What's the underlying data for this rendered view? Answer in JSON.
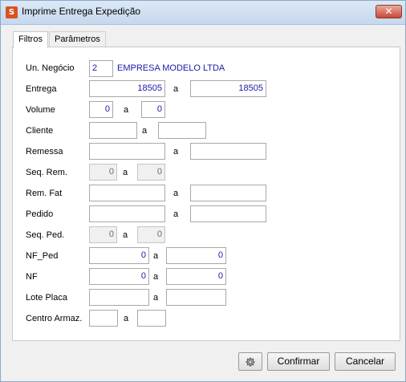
{
  "window": {
    "title": "Imprime Entrega Expedição",
    "close_glyph": "✕",
    "app_icon": "app-icon",
    "app_icon_glyph": "S"
  },
  "tabs": [
    {
      "label": "Filtros",
      "active": true
    },
    {
      "label": "Parâmetros",
      "active": false
    }
  ],
  "form": {
    "separator": "a",
    "un_negocio": {
      "label": "Un. Negócio",
      "value": "2",
      "company": "EMPRESA MODELO LTDA"
    },
    "entrega": {
      "label": "Entrega",
      "from": "18505",
      "to": "18505"
    },
    "volume": {
      "label": "Volume",
      "from": "0",
      "to": "0"
    },
    "cliente": {
      "label": "Cliente",
      "from": "",
      "to": ""
    },
    "remessa": {
      "label": "Remessa",
      "from": "",
      "to": ""
    },
    "seq_rem": {
      "label": "Seq. Rem.",
      "from": "0",
      "to": "0"
    },
    "rem_fat": {
      "label": "Rem. Fat",
      "from": "",
      "to": ""
    },
    "pedido": {
      "label": "Pedido",
      "from": "",
      "to": ""
    },
    "seq_ped": {
      "label": "Seq. Ped.",
      "from": "0",
      "to": "0"
    },
    "nf_ped": {
      "label": "NF_Ped",
      "from": "0",
      "to": "0"
    },
    "nf": {
      "label": "NF",
      "from": "0",
      "to": "0"
    },
    "lote_placa": {
      "label": "Lote Placa",
      "from": "",
      "to": ""
    },
    "centro_armaz": {
      "label": "Centro Armaz.",
      "from": "",
      "to": ""
    }
  },
  "footer": {
    "settings_icon": "gear-icon",
    "confirm_label": "Confirmar",
    "cancel_label": "Cancelar"
  }
}
